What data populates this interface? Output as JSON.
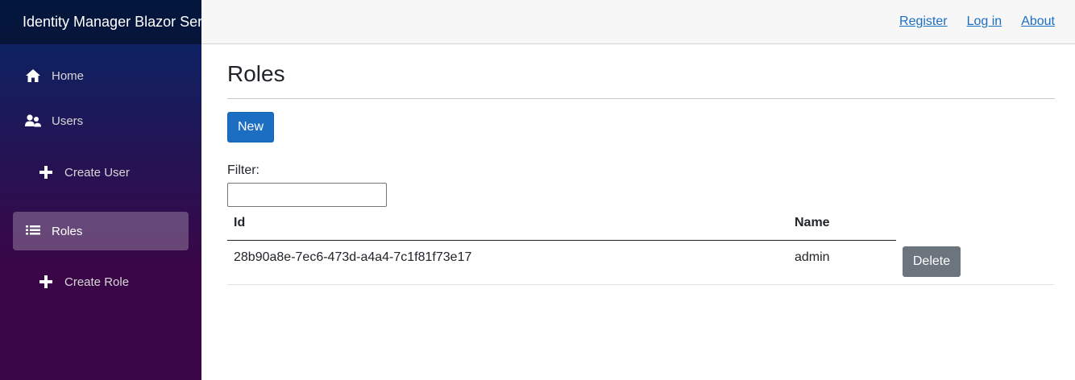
{
  "sidebar": {
    "brand": "Identity Manager Blazor Server",
    "items": [
      {
        "label": "Home",
        "icon": "home-icon"
      },
      {
        "label": "Users",
        "icon": "users-icon"
      },
      {
        "label": "Create User",
        "icon": "plus-icon"
      },
      {
        "label": "Roles",
        "icon": "list-icon",
        "active": true
      },
      {
        "label": "Create Role",
        "icon": "plus-icon"
      }
    ]
  },
  "top_bar": {
    "links": [
      "Register",
      "Log in",
      "About"
    ]
  },
  "main": {
    "title": "Roles",
    "new_button": "New",
    "filter_label": "Filter:",
    "filter_value": "",
    "table": {
      "headers": [
        "Id",
        "Name"
      ],
      "rows": [
        {
          "id": "28b90a8e-7ec6-473d-a4a4-7c1f81f73e17",
          "name": "admin",
          "action": "Delete"
        }
      ]
    }
  },
  "colors": {
    "primary": "#1b6ec2",
    "secondary": "#6c757d",
    "sidebar_top": "#052767",
    "sidebar_bottom": "#3a0647"
  }
}
